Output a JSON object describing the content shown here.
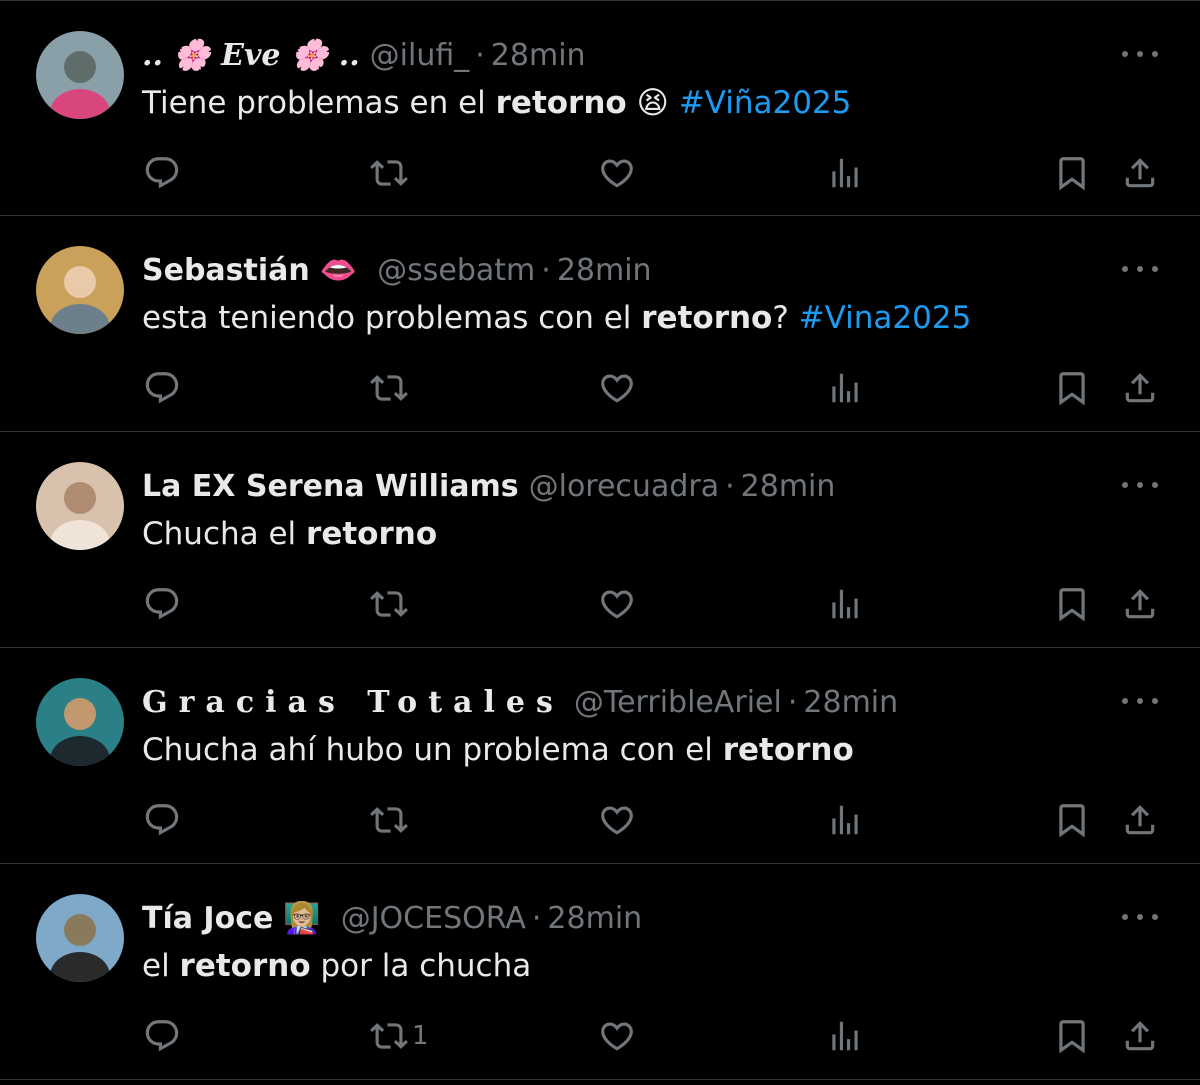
{
  "tweets": [
    {
      "name": ".. 🌸 𝑬𝒗𝒆 🌸 ..",
      "name_style": "italic",
      "handle": "@ilufi_",
      "separator": "·",
      "time": "28min",
      "text": [
        {
          "t": "Tiene problemas en el ",
          "s": "normal"
        },
        {
          "t": "retorno",
          "s": "bold"
        },
        {
          "t": " 😫 ",
          "s": "normal"
        },
        {
          "t": "#Viña2025",
          "s": "hashtag"
        }
      ],
      "retweets": "",
      "avatar_colors": [
        "#8aa0a8",
        "#5f6e6a",
        "#d9467e"
      ]
    },
    {
      "name": "Sebastián",
      "name_emoji": "👄",
      "handle": "@ssebatm",
      "separator": "·",
      "time": "28min",
      "text": [
        {
          "t": "esta teniendo problemas con el ",
          "s": "normal"
        },
        {
          "t": "retorno",
          "s": "bold"
        },
        {
          "t": "? ",
          "s": "normal"
        },
        {
          "t": "#Vina2025",
          "s": "hashtag"
        }
      ],
      "retweets": "",
      "avatar_colors": [
        "#c9a15a",
        "#e8c9a8",
        "#6d7f8a"
      ]
    },
    {
      "name": "La EX Serena Williams",
      "handle": "@lorecuadra",
      "separator": "·",
      "time": "28min",
      "text": [
        {
          "t": "Chucha el ",
          "s": "normal"
        },
        {
          "t": "retorno",
          "s": "bold"
        }
      ],
      "retweets": "",
      "avatar_colors": [
        "#d8c2ae",
        "#b08c72",
        "#f0e4d8"
      ]
    },
    {
      "name": "Gracias Totales",
      "name_style": "spaced",
      "handle": "@TerribleAriel",
      "separator": "·",
      "time": "28min",
      "text": [
        {
          "t": "Chucha ahí hubo un problema con el ",
          "s": "normal"
        },
        {
          "t": "retorno",
          "s": "bold"
        }
      ],
      "retweets": "",
      "avatar_colors": [
        "#2b7f86",
        "#c2996e",
        "#1c2a30"
      ]
    },
    {
      "name": "Tía Joce",
      "name_emoji": "👩🏼‍🏫",
      "handle": "@JOCESORA",
      "separator": "·",
      "time": "28min",
      "text": [
        {
          "t": "el ",
          "s": "normal"
        },
        {
          "t": "retorno",
          "s": "bold"
        },
        {
          "t": " por la chucha",
          "s": "normal"
        }
      ],
      "retweets": "1",
      "avatar_colors": [
        "#7fa9c9",
        "#8a7a5c",
        "#2a2a2a"
      ]
    }
  ],
  "icons": {
    "reply": "reply-icon",
    "retweet": "retweet-icon",
    "like": "like-icon",
    "views": "views-icon",
    "bookmark": "bookmark-icon",
    "share": "share-icon",
    "more": "more-icon"
  },
  "colors": {
    "background": "#000000",
    "text": "#e7e9ea",
    "muted": "#71767b",
    "hashtag": "#1d9bf0",
    "divider": "#2f3336"
  }
}
